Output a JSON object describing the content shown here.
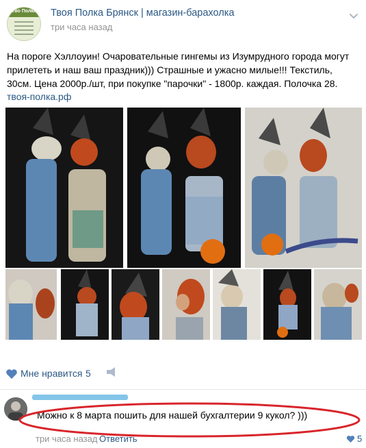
{
  "header": {
    "avatar_caption": "Тво Полка",
    "group_name": "Твоя Полка Брянск | магазин-барахолка",
    "time": "три часа назад"
  },
  "post": {
    "text": "На пороге Хэллоуин! Очаровательные гингемы из Изумрудного города могут прилететь и наш ваш праздник))) Страшные и ужасно милые!!! Текстиль, 30см. Цена 2000р./шт, при покупке \"парочки\" - 1800р. каждая. Полочка 28.",
    "link": "твоя-полка.рф"
  },
  "footer": {
    "like_label": "Мне нравится",
    "like_count": "5"
  },
  "comment": {
    "text": "Можно к 8 марта пошить для нашей бухгалтерии 9 кукол? )))",
    "time": "три часа назад",
    "reply": "Ответить",
    "like_count": "5"
  },
  "colors": {
    "link": "#2a5885",
    "muted": "#939393",
    "annotation": "#d8252b"
  }
}
